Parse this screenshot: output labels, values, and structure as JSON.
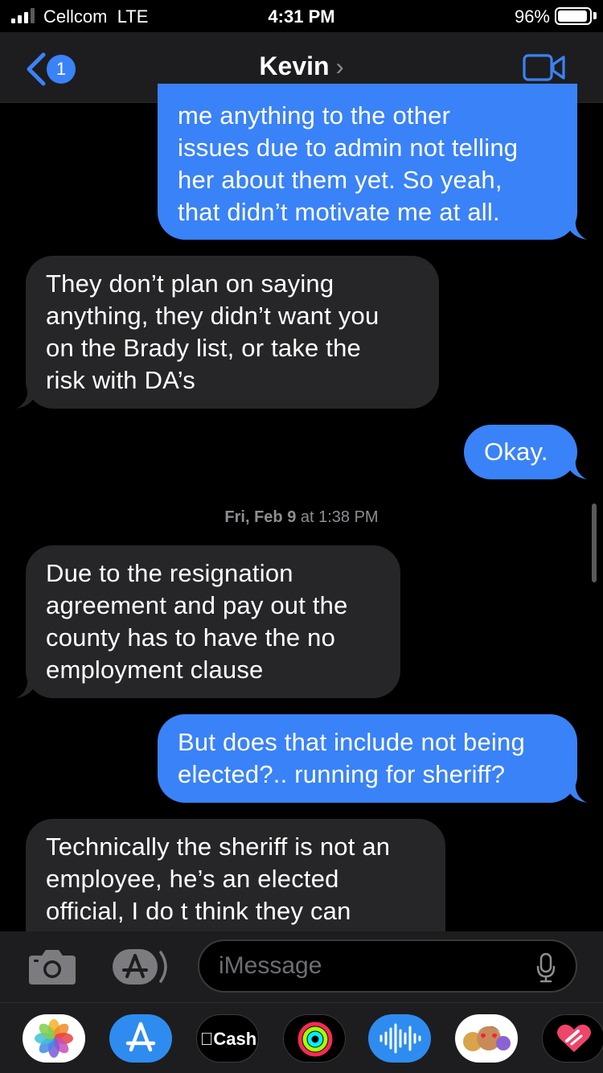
{
  "status_bar": {
    "carrier": "Cellcom",
    "network": "LTE",
    "time": "4:31 PM",
    "battery": "96%",
    "battery_level": 0.96
  },
  "header": {
    "back_badge": "1",
    "contact_name": "Kevin",
    "chevron": "›",
    "video_icon": "video-camera-icon"
  },
  "messages": [
    {
      "type": "sent",
      "lines": [
        "me anything to the other",
        "issues due to admin not telling",
        "her about them yet. So yeah,",
        "that didn’t motivate me at all."
      ]
    },
    {
      "type": "received",
      "lines": [
        "They don’t plan on saying",
        "anything, they didn’t want you",
        "on the Brady list, or take the",
        "risk with DA’s"
      ]
    },
    {
      "type": "sent",
      "lines": [
        "Okay."
      ]
    },
    {
      "type": "received",
      "lines": [
        "Due to the resignation",
        "agreement and pay out the",
        "county has to have the no",
        "employment clause"
      ]
    },
    {
      "type": "sent",
      "lines": [
        "But does that include not being",
        "elected?.. running for sheriff?"
      ]
    },
    {
      "type": "received",
      "lines": [
        "Technically the sheriff is not an",
        "employee, he’s an elected",
        "official, I do t think they can"
      ]
    }
  ],
  "timestamp": {
    "day": "Fri, Feb 9",
    "time": "at 1:38 PM"
  },
  "input": {
    "placeholder": "iMessage"
  },
  "app_drawer": {
    "apps": [
      "photos-icon",
      "app-store-icon",
      "cash-app-icon",
      "activity-icon",
      "voice-memo-icon",
      "memoji-icon",
      "digital-touch-icon"
    ],
    "cash_label": "Cash"
  },
  "colors": {
    "sent_bubble": "#3a82f7",
    "received_bubble": "#262628",
    "background": "#000000"
  }
}
